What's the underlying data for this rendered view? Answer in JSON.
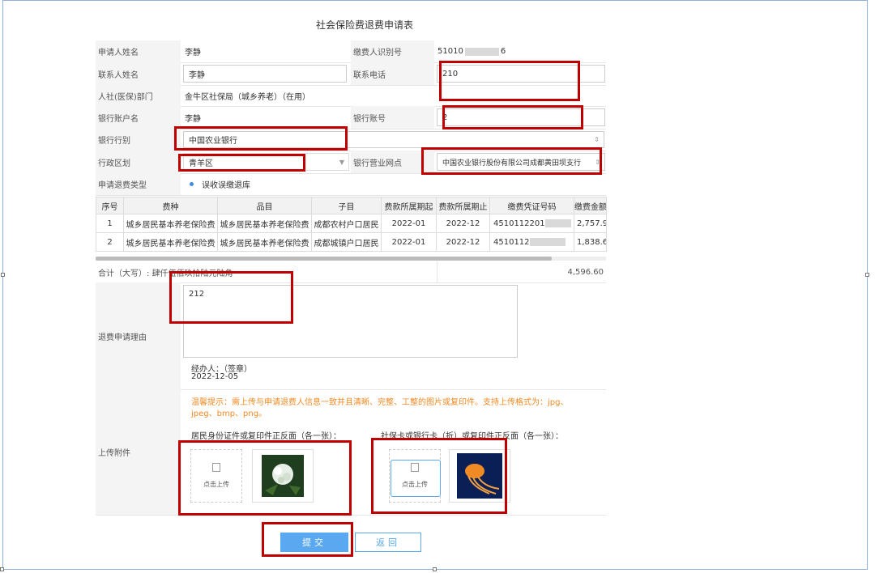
{
  "title": "社会保险费退费申请表",
  "applicant": {
    "label": "申请人姓名",
    "value": "李静"
  },
  "payer_id": {
    "label": "缴费人识别号",
    "value_prefix": "51010",
    "value_suffix": "6"
  },
  "contact_name": {
    "label": "联系人姓名",
    "value": "李静"
  },
  "contact_phone": {
    "label": "联系电话",
    "value": "210"
  },
  "department": {
    "label": "人社(医保)部门",
    "value": "金牛区社保局（城乡养老）（在用）"
  },
  "bank_account_name": {
    "label": "银行账户名",
    "value": "李静"
  },
  "bank_account_no": {
    "label": "银行账号",
    "value": "2"
  },
  "bank_type": {
    "label": "银行行别",
    "value": "中国农业银行"
  },
  "district": {
    "label": "行政区划",
    "value": "青羊区"
  },
  "bank_branch": {
    "label": "银行营业网点",
    "value": "中国农业银行股份有限公司成都黄田坝支行"
  },
  "refund_type": {
    "label": "申请退费类型",
    "option": "误收误缴退库"
  },
  "fee_table": {
    "headers": [
      "序号",
      "费种",
      "品目",
      "子目",
      "费款所属期起",
      "费款所属期止",
      "缴费凭证号码",
      "缴费金额"
    ],
    "rows": [
      {
        "no": "1",
        "kind": "城乡居民基本养老保险费",
        "item": "城乡居民基本养老保险费",
        "sub": "成都农村户口居民",
        "start": "2022-01",
        "end": "2022-12",
        "voucher": "4510112201",
        "amount": "2,757.9"
      },
      {
        "no": "2",
        "kind": "城乡居民基本养老保险费",
        "item": "城乡居民基本养老保险费",
        "sub": "成都城镇户口居民",
        "start": "2022-01",
        "end": "2022-12",
        "voucher": "4510112",
        "amount": "1,838.6"
      }
    ]
  },
  "total": {
    "label": "合计（大写）: 肆仟伍佰玖拾陆元陆角",
    "value": "4,596.60"
  },
  "reason": {
    "label": "退费申请理由",
    "value": "212",
    "handler": "经办人：（签章）",
    "date": "2022-12-05"
  },
  "upload": {
    "label": "上传附件",
    "tip": "温馨提示：需上传与申请退费人信息一致并且清晰、完整、工整的图片或复印件。支持上传格式为：jpg、jpeg、bmp、png。",
    "id_label": "居民身份证件或复印件正反面（各一张）：",
    "card_label": "社保卡或银行卡（折）或复印件正反面（各一张）：",
    "click_upload": "点击上传"
  },
  "buttons": {
    "submit": "提交",
    "back": "返回"
  },
  "colors": {
    "accent": "#5aa9f0",
    "highlight": "#c00000",
    "tip": "#f08a24"
  }
}
